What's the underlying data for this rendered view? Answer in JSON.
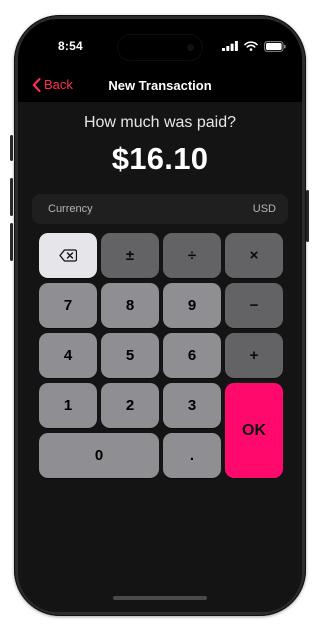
{
  "status_bar": {
    "time": "8:54"
  },
  "nav": {
    "back_label": "Back",
    "title": "New Transaction"
  },
  "prompt": {
    "question": "How much was paid?",
    "amount": "$16.10"
  },
  "currency": {
    "label": "Currency",
    "value": "USD"
  },
  "keypad": {
    "plus": "±",
    "divide": "÷",
    "multiply": "×",
    "minus": "−",
    "add": "+",
    "seven": "7",
    "eight": "8",
    "nine": "9",
    "four": "4",
    "five": "5",
    "six": "6",
    "one": "1",
    "two": "2",
    "three": "3",
    "zero": "0",
    "dot": ".",
    "ok": "OK"
  },
  "colors": {
    "accent": "#ff2d55",
    "ok_button": "#ff0a6c",
    "key": "#8e8e93",
    "key_operator": "#636366"
  },
  "icons": [
    "chevron-left-icon",
    "backspace-icon",
    "signal-icon",
    "wifi-icon",
    "battery-icon"
  ]
}
